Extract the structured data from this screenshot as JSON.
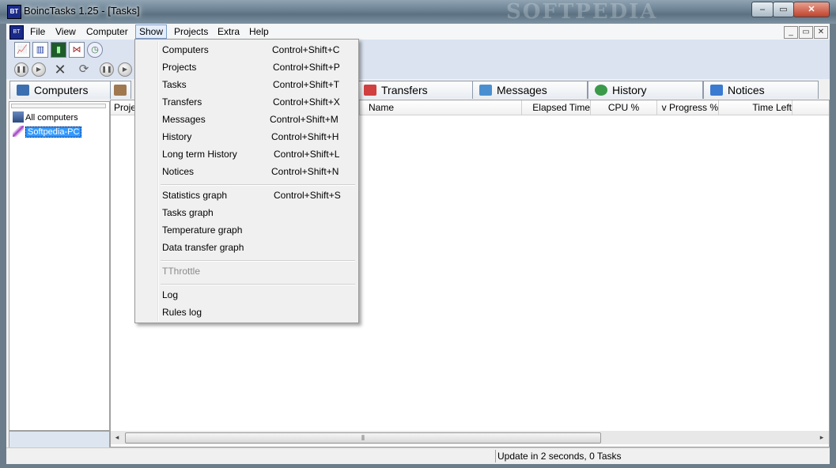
{
  "window": {
    "title": "BoincTasks 1.25 - [Tasks]",
    "app_icon_text": "BT",
    "watermark": "SOFTPEDIA",
    "controls": {
      "minimize": "‒",
      "maximize": "▭",
      "close": "✕"
    }
  },
  "menubar": {
    "items": [
      "File",
      "View",
      "Computer",
      "Show",
      "Projects",
      "Extra",
      "Help"
    ],
    "mdi": {
      "minimize": "_",
      "restore": "▭",
      "close": "✕"
    }
  },
  "tabs": [
    {
      "label": "Computers",
      "icon": "computer-icon"
    },
    {
      "label": "Transfers",
      "icon": "transfers-icon"
    },
    {
      "label": "Messages",
      "icon": "messages-icon"
    },
    {
      "label": "History",
      "icon": "history-icon"
    },
    {
      "label": "Notices",
      "icon": "notices-icon"
    }
  ],
  "tree": {
    "items": [
      {
        "label": "All computers",
        "icon": "computers-group-icon"
      },
      {
        "label": "Softpedia-PC",
        "icon": "computer-node-icon",
        "selected": true
      }
    ]
  },
  "list": {
    "columns": [
      "Proje",
      "Name",
      "Elapsed Time",
      "CPU %",
      "v Progress %",
      "Time Left"
    ],
    "scroll_grip": "⦀"
  },
  "status": {
    "text": "Update in 2 seconds, 0 Tasks"
  },
  "show_menu": {
    "items": [
      {
        "label": "Computers",
        "shortcut": "Control+Shift+C"
      },
      {
        "label": "Projects",
        "shortcut": "Control+Shift+P"
      },
      {
        "label": "Tasks",
        "shortcut": "Control+Shift+T"
      },
      {
        "label": "Transfers",
        "shortcut": "Control+Shift+X"
      },
      {
        "label": "Messages",
        "shortcut": "Control+Shift+M"
      },
      {
        "label": "History",
        "shortcut": "Control+Shift+H"
      },
      {
        "label": "Long term History",
        "shortcut": "Control+Shift+L"
      },
      {
        "label": "Notices",
        "shortcut": "Control+Shift+N"
      },
      {
        "label": "Statistics graph",
        "shortcut": "Control+Shift+S"
      },
      {
        "label": "Tasks graph",
        "shortcut": ""
      },
      {
        "label": "Temperature graph",
        "shortcut": ""
      },
      {
        "label": "Data transfer graph",
        "shortcut": ""
      },
      {
        "label": "TThrottle",
        "shortcut": "",
        "disabled": true
      },
      {
        "label": "Log",
        "shortcut": ""
      },
      {
        "label": "Rules log",
        "shortcut": ""
      }
    ]
  }
}
